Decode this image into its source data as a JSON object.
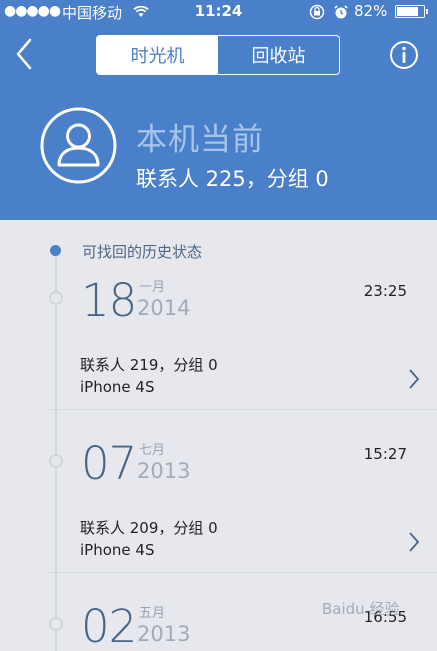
{
  "statusbar": {
    "signal": "●●●●●",
    "carrier": "中国移动",
    "time": "11:24",
    "battery": "82%",
    "battery_level": 0.82
  },
  "nav": {
    "tabs": [
      {
        "label": "时光机",
        "active": true
      },
      {
        "label": "回收站",
        "active": false
      }
    ]
  },
  "header": {
    "title": "本机当前",
    "subtitle": "联系人 225，分组 0"
  },
  "timeline": {
    "heading": "可找回的历史状态",
    "entries": [
      {
        "day": "18",
        "month": "一月",
        "year": "2014",
        "time": "23:25",
        "summary": "联系人 219，分组 0",
        "device": "iPhone 4S"
      },
      {
        "day": "07",
        "month": "七月",
        "year": "2013",
        "time": "15:27",
        "summary": "联系人 209，分组 0",
        "device": "iPhone 4S"
      },
      {
        "day": "02",
        "month": "五月",
        "year": "2013",
        "time": "16:55"
      }
    ]
  },
  "watermark": "Baidu 经验",
  "colors": {
    "primary": "#4a7fc9",
    "background": "#e6e8ee",
    "timeline_dot": "#4a7fc9"
  },
  "icons": [
    "back-icon",
    "info-icon",
    "avatar-icon",
    "chevron-right-icon",
    "wifi-icon",
    "lock-rotation-icon",
    "alarm-icon",
    "battery-icon"
  ]
}
